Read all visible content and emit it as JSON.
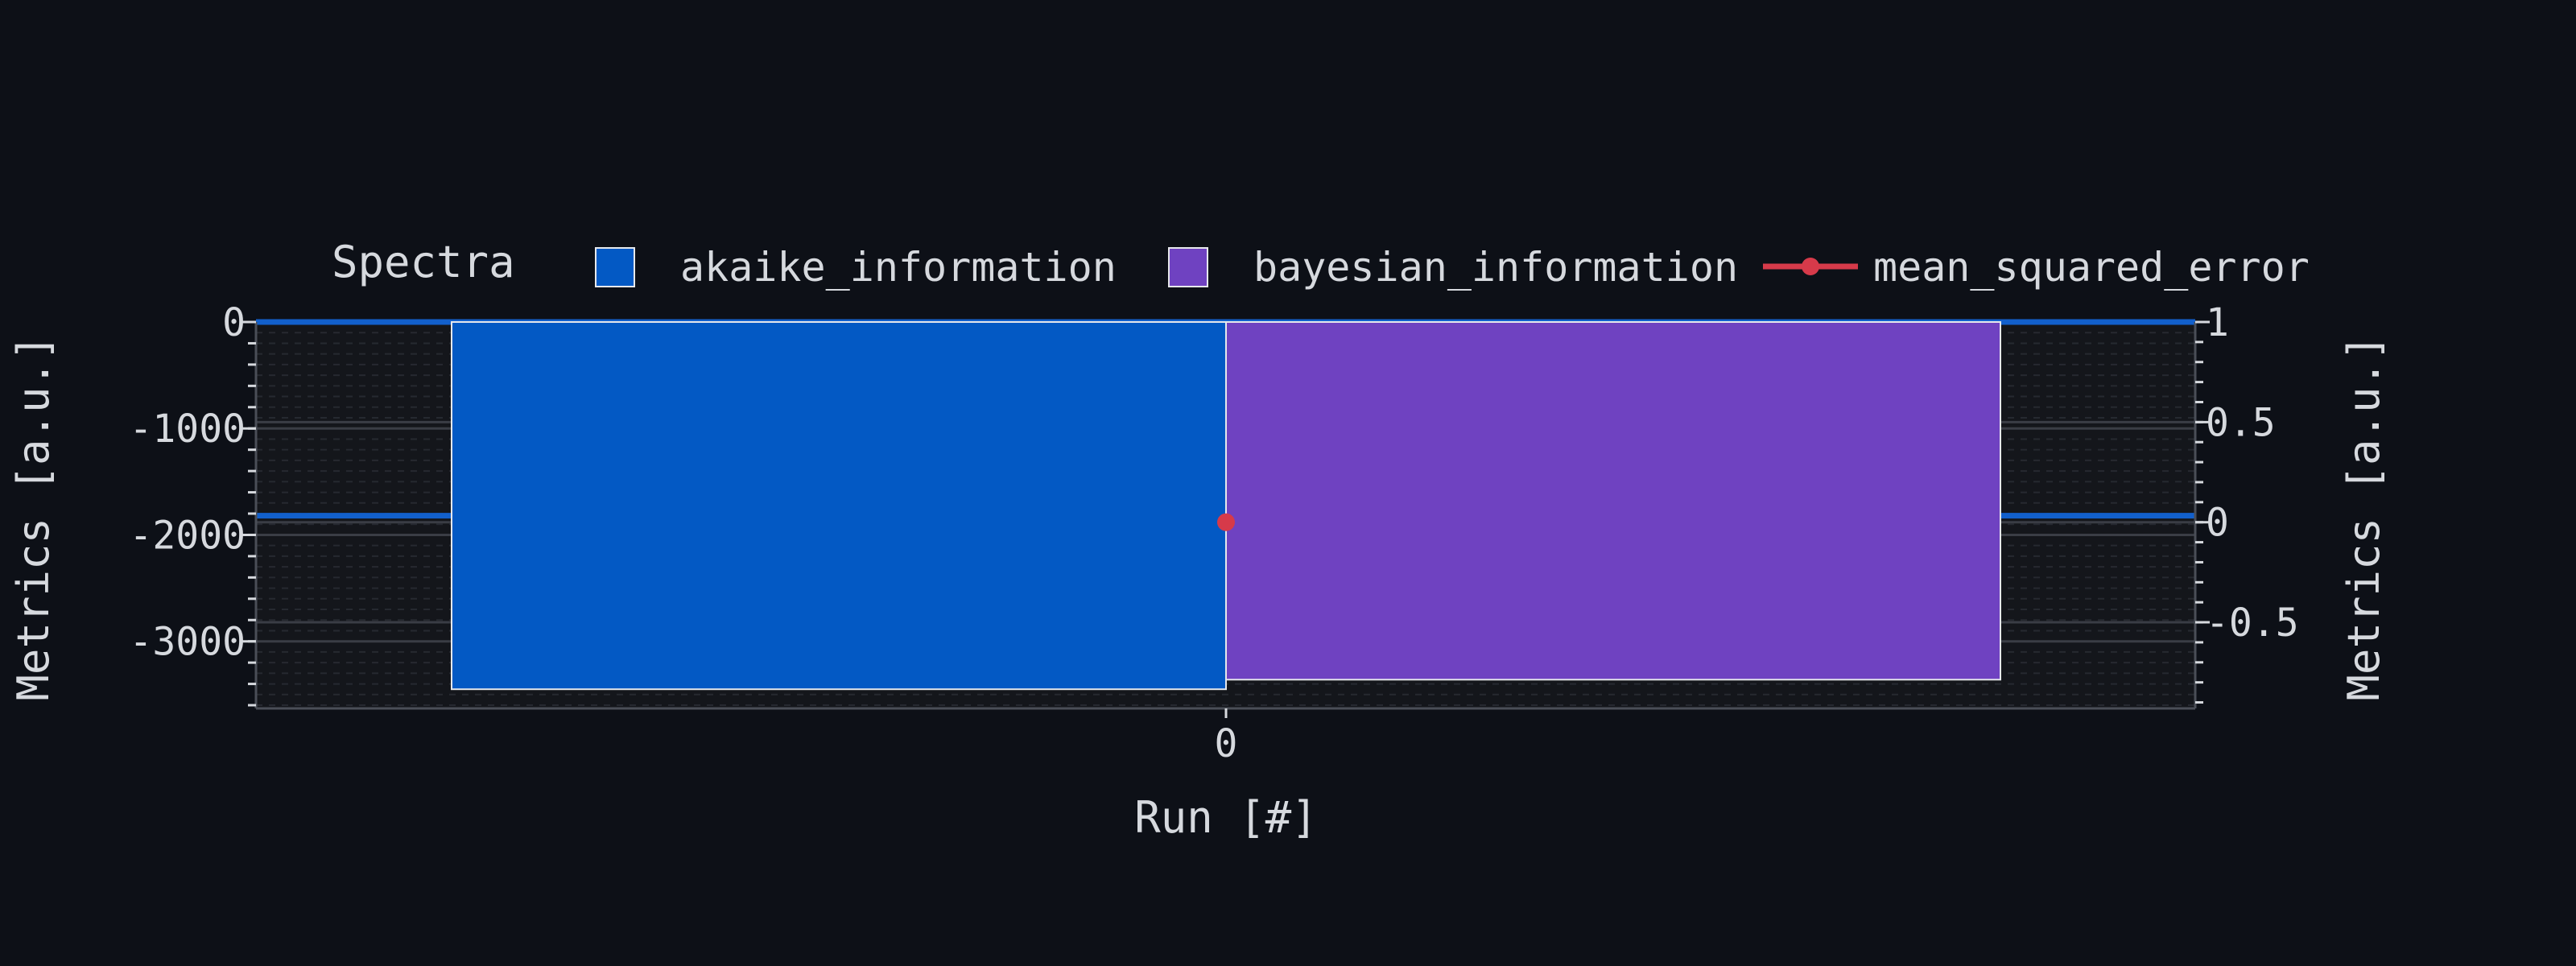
{
  "chart_data": {
    "type": "bar",
    "categories": [
      "0"
    ],
    "legend_title": "Spectra",
    "legend_placement": "top",
    "xlabel": "Run [#]",
    "ylabel": "Metrics [a.u.]",
    "y2label": "Metrics [a.u.]",
    "ylim": [
      -3630,
      0
    ],
    "y2lim": [
      -0.93,
      1.0
    ],
    "yticks": [
      0,
      -1000,
      -2000,
      -3000
    ],
    "y2ticks": [
      1,
      0.5,
      0,
      -0.5
    ],
    "grid": true,
    "series": [
      {
        "name": "akaike_information",
        "kind": "bar",
        "axis": "left",
        "values": [
          -3450
        ],
        "color": "#0359c4"
      },
      {
        "name": "bayesian_information",
        "kind": "bar",
        "axis": "left",
        "values": [
          -3360
        ],
        "color": "#6f42c1"
      },
      {
        "name": "mean_squared_error",
        "kind": "line",
        "axis": "right",
        "values": [
          0.0
        ],
        "color": "#d63a4a"
      }
    ],
    "reference_lines": [
      {
        "axis": "left",
        "value": 0,
        "color": "#1260cc"
      },
      {
        "axis": "left",
        "value": -1820,
        "color": "#1260cc"
      }
    ]
  }
}
